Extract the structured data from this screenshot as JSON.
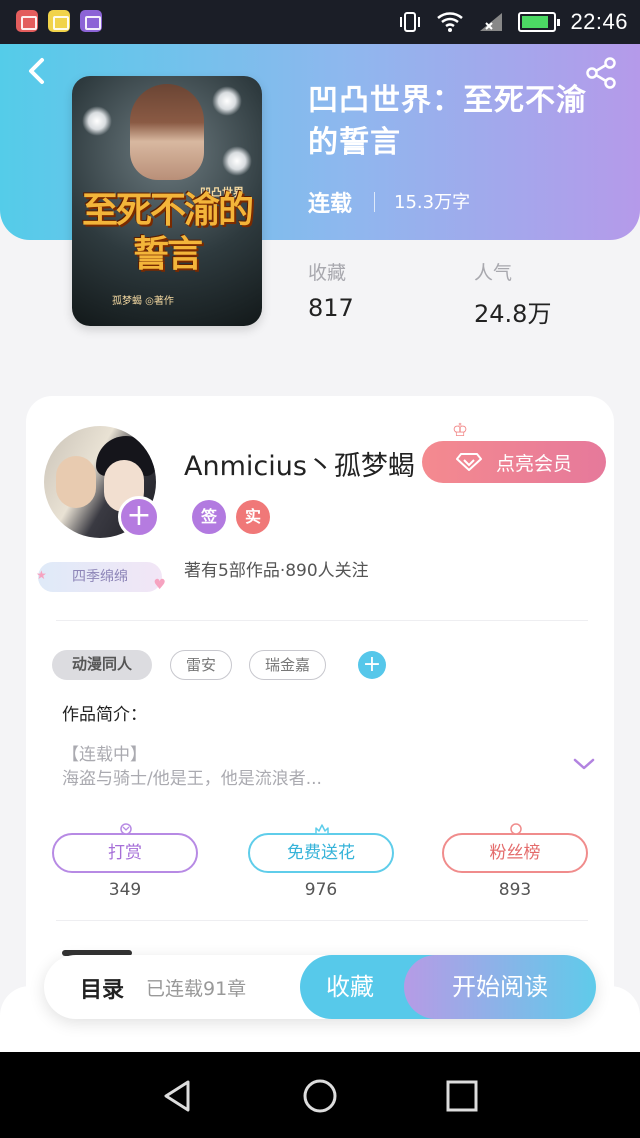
{
  "status_bar": {
    "time": "22:46",
    "apps": [
      "mail-icon",
      "wechat-icon",
      "gallery-icon"
    ],
    "indicators": [
      "vibrate-icon",
      "wifi-icon",
      "signal-icon",
      "battery-icon"
    ]
  },
  "header": {
    "back_icon": "chevron-left-icon",
    "share_icon": "share-icon",
    "colors": {
      "gradient_start": "#54cce9",
      "gradient_end": "#b59aea"
    }
  },
  "book": {
    "title": "凹凸世界：至死不渝的誓言",
    "status": "连载",
    "word_count": "15.3万字",
    "cover": {
      "series_text": "凹凸世界",
      "title_text": "至死不渝的誓言",
      "author_text": "孤梦蝎 ◎著作"
    },
    "stats": [
      {
        "label": "收藏",
        "value": "817"
      },
      {
        "label": "人气",
        "value": "24.8万"
      }
    ]
  },
  "author": {
    "name": "Anmicius丶孤梦蝎",
    "vip_button": "点亮会员",
    "tags": [
      "签",
      "实"
    ],
    "badge": "四季绵绵",
    "meta": "著有5部作品·890人关注"
  },
  "categories": {
    "primary": "动漫同人",
    "tags": [
      "雷安",
      "瑞金嘉"
    ]
  },
  "intro": {
    "label": "作品简介：",
    "status_line": "【连载中】",
    "text": "海盗与骑士/他是王，他是流浪者..."
  },
  "actions": [
    {
      "label": "打赏",
      "count": "349",
      "color": "#b78ae4"
    },
    {
      "label": "免费送花",
      "count": "976",
      "color": "#5fcdea"
    },
    {
      "label": "粉丝榜",
      "count": "893",
      "color": "#f08c8c"
    }
  ],
  "bottom_bar": {
    "toc_label": "目录",
    "chapters": "已连载91章",
    "collect_label": "收藏",
    "read_label": "开始阅读"
  }
}
